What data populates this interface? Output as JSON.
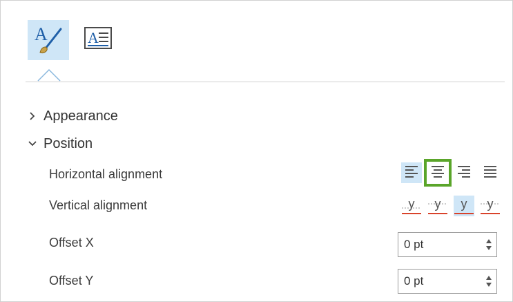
{
  "tabs": [
    {
      "id": "symbol",
      "icon": "symbol-brush-icon",
      "selected": true
    },
    {
      "id": "text",
      "icon": "text-properties-icon",
      "selected": false
    }
  ],
  "sections": {
    "appearance": {
      "label": "Appearance",
      "expanded": false
    },
    "position": {
      "label": "Position",
      "expanded": true
    }
  },
  "rows": {
    "horizontal_alignment": {
      "label": "Horizontal alignment",
      "options": [
        "align-left-icon",
        "align-center-icon",
        "align-right-icon",
        "align-justify-icon"
      ],
      "selected_index": 0,
      "highlighted_index": 1
    },
    "vertical_alignment": {
      "label": "Vertical alignment",
      "glyph": "y",
      "options": [
        "baseline",
        "bottom",
        "center",
        "top"
      ],
      "selected_index": 2
    },
    "offset_x": {
      "label": "Offset X",
      "value": "0 pt"
    },
    "offset_y": {
      "label": "Offset Y",
      "value": "0 pt"
    }
  },
  "colors": {
    "accent_selected": "#cfe6f7",
    "highlight": "#5aa52a",
    "baseline_red": "#d9432b"
  }
}
